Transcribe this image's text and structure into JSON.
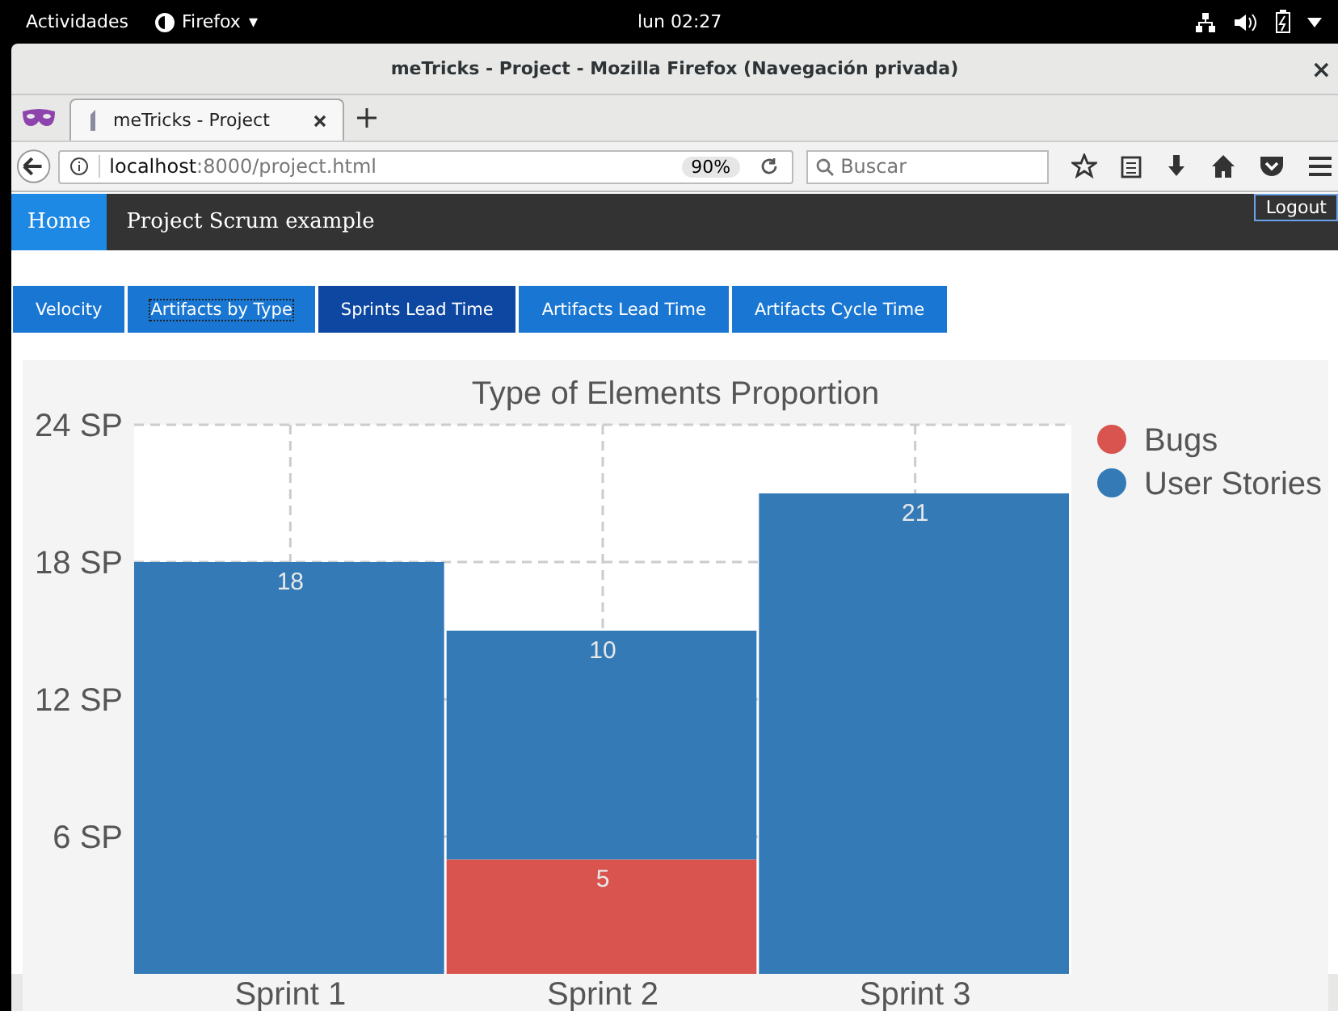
{
  "system_bar": {
    "activities": "Actividades",
    "app": "Firefox",
    "app_caret": "▾",
    "clock": "lun 02:27"
  },
  "window": {
    "title": "meTricks - Project - Mozilla Firefox (Navegación privada)",
    "close": "×"
  },
  "browser_tabs": [
    {
      "label": "meTricks - Project",
      "selected": true
    }
  ],
  "address_bar": {
    "host": "localhost",
    "path": ":8000/project.html",
    "zoom": "90%"
  },
  "search": {
    "placeholder": "Buscar"
  },
  "navbar": {
    "home": "Home",
    "project": "Project Scrum example",
    "logout": "Logout"
  },
  "tabs": [
    {
      "label": "Velocity",
      "selected": false,
      "focused": false
    },
    {
      "label": "Artifacts by Type",
      "selected": false,
      "focused": true
    },
    {
      "label": "Sprints Lead Time",
      "selected": true,
      "focused": false
    },
    {
      "label": "Artifacts Lead Time",
      "selected": false,
      "focused": false
    },
    {
      "label": "Artifacts Cycle Time",
      "selected": false,
      "focused": false
    }
  ],
  "chart": {
    "chart_data": {
      "type": "bar",
      "title": "Type of Elements Proportion",
      "categories": [
        "Sprint 1",
        "Sprint 2",
        "Sprint 3"
      ],
      "stacked": true,
      "grid": true,
      "legend": true,
      "ylim": [
        0,
        24
      ],
      "yticks": [
        {
          "value": 6,
          "label": "6 SP"
        },
        {
          "value": 12,
          "label": "12 SP"
        },
        {
          "value": 18,
          "label": "18 SP"
        },
        {
          "value": 24,
          "label": "24 SP"
        }
      ],
      "data_labels": true,
      "series": [
        {
          "name": "Bugs",
          "color": "#d9534f",
          "values": [
            null,
            5,
            null
          ]
        },
        {
          "name": "User Stories",
          "color": "#337ab7",
          "values": [
            18,
            10,
            21
          ]
        }
      ]
    }
  }
}
